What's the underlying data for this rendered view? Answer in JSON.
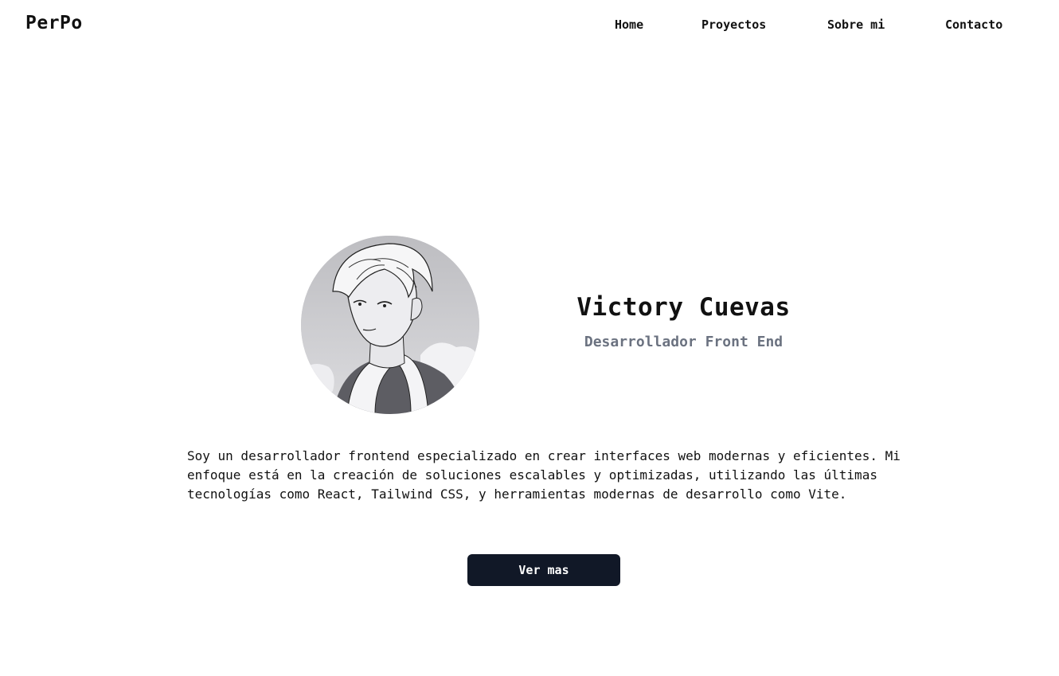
{
  "brand": {
    "logo": "PerPo"
  },
  "nav": {
    "items": [
      {
        "label": "Home"
      },
      {
        "label": "Proyectos"
      },
      {
        "label": "Sobre mi"
      },
      {
        "label": "Contacto"
      }
    ]
  },
  "hero": {
    "name": "Victory Cuevas",
    "role": "Desarrollador Front End",
    "bio": "Soy un desarrollador frontend especializado en crear interfaces web modernas y eficientes. Mi enfoque está en la creación de soluciones escalables y optimizadas, utilizando las últimas tecnologías como React, Tailwind CSS, y herramientas modernas de desarrollo como Vite.",
    "cta_label": "Ver mas"
  },
  "colors": {
    "background": "#ffffff",
    "text": "#111111",
    "muted_text": "#6b7280",
    "button_bg": "#111827",
    "button_text": "#ffffff"
  }
}
